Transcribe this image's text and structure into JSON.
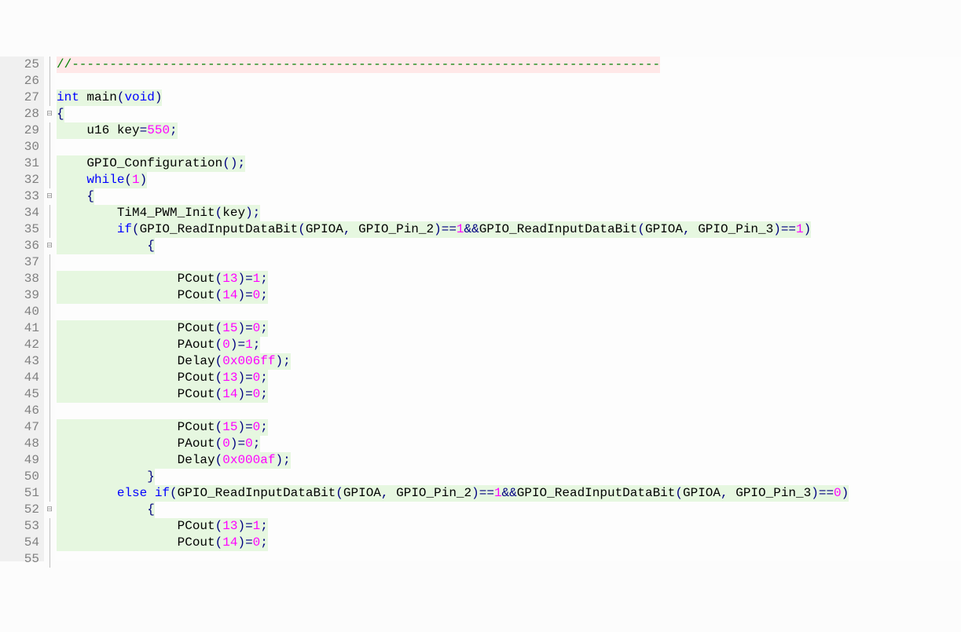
{
  "lines": [
    {
      "num": "25",
      "fold": "line",
      "tokens": [
        {
          "cls": "comment hl",
          "t": "//------------------------------------------------------------------------------"
        }
      ]
    },
    {
      "num": "26",
      "fold": "line",
      "tokens": []
    },
    {
      "num": "27",
      "fold": "line",
      "tokens": [
        {
          "cls": "type",
          "t": "int"
        },
        {
          "cls": "plain",
          "t": " main"
        },
        {
          "cls": "punc",
          "t": "("
        },
        {
          "cls": "type",
          "t": "void"
        },
        {
          "cls": "punc",
          "t": ")"
        }
      ]
    },
    {
      "num": "28",
      "fold": "open",
      "tokens": [
        {
          "cls": "punc",
          "t": "{"
        }
      ]
    },
    {
      "num": "29",
      "fold": "line",
      "tokens": [
        {
          "cls": "plain",
          "t": "    u16 key"
        },
        {
          "cls": "operator",
          "t": "="
        },
        {
          "cls": "number",
          "t": "550"
        },
        {
          "cls": "punc",
          "t": ";"
        }
      ]
    },
    {
      "num": "30",
      "fold": "line",
      "tokens": []
    },
    {
      "num": "31",
      "fold": "line",
      "tokens": [
        {
          "cls": "plain",
          "t": "    GPIO_Configuration"
        },
        {
          "cls": "punc",
          "t": "();"
        }
      ]
    },
    {
      "num": "32",
      "fold": "line",
      "tokens": [
        {
          "cls": "plain",
          "t": "    "
        },
        {
          "cls": "keyword",
          "t": "while"
        },
        {
          "cls": "punc",
          "t": "("
        },
        {
          "cls": "number",
          "t": "1"
        },
        {
          "cls": "punc",
          "t": ")"
        }
      ]
    },
    {
      "num": "33",
      "fold": "open",
      "tokens": [
        {
          "cls": "punc",
          "t": "    {"
        }
      ]
    },
    {
      "num": "34",
      "fold": "line",
      "tokens": [
        {
          "cls": "plain",
          "t": "        TiM4_PWM_Init"
        },
        {
          "cls": "punc",
          "t": "("
        },
        {
          "cls": "plain",
          "t": "key"
        },
        {
          "cls": "punc",
          "t": ");"
        }
      ]
    },
    {
      "num": "35",
      "fold": "line",
      "tokens": [
        {
          "cls": "plain",
          "t": "        "
        },
        {
          "cls": "keyword",
          "t": "if"
        },
        {
          "cls": "punc",
          "t": "("
        },
        {
          "cls": "plain",
          "t": "GPIO_ReadInputDataBit"
        },
        {
          "cls": "punc",
          "t": "("
        },
        {
          "cls": "plain",
          "t": "GPIOA"
        },
        {
          "cls": "punc",
          "t": ", "
        },
        {
          "cls": "plain",
          "t": "GPIO_Pin_2"
        },
        {
          "cls": "punc",
          "t": ")"
        },
        {
          "cls": "operator",
          "t": "=="
        },
        {
          "cls": "number",
          "t": "1"
        },
        {
          "cls": "operator",
          "t": "&&"
        },
        {
          "cls": "plain",
          "t": "GPIO_ReadInputDataBit"
        },
        {
          "cls": "punc",
          "t": "("
        },
        {
          "cls": "plain",
          "t": "GPIOA"
        },
        {
          "cls": "punc",
          "t": ", "
        },
        {
          "cls": "plain",
          "t": "GPIO_Pin_3"
        },
        {
          "cls": "punc",
          "t": ")"
        },
        {
          "cls": "operator",
          "t": "=="
        },
        {
          "cls": "number",
          "t": "1"
        },
        {
          "cls": "punc",
          "t": ")"
        }
      ]
    },
    {
      "num": "36",
      "fold": "open",
      "tokens": [
        {
          "cls": "punc",
          "t": "            {"
        }
      ]
    },
    {
      "num": "37",
      "fold": "line",
      "tokens": []
    },
    {
      "num": "38",
      "fold": "line",
      "tokens": [
        {
          "cls": "plain",
          "t": "                PCout"
        },
        {
          "cls": "punc",
          "t": "("
        },
        {
          "cls": "number",
          "t": "13"
        },
        {
          "cls": "punc",
          "t": ")"
        },
        {
          "cls": "operator",
          "t": "="
        },
        {
          "cls": "number",
          "t": "1"
        },
        {
          "cls": "punc",
          "t": ";"
        }
      ]
    },
    {
      "num": "39",
      "fold": "line",
      "tokens": [
        {
          "cls": "plain",
          "t": "                PCout"
        },
        {
          "cls": "punc",
          "t": "("
        },
        {
          "cls": "number",
          "t": "14"
        },
        {
          "cls": "punc",
          "t": ")"
        },
        {
          "cls": "operator",
          "t": "="
        },
        {
          "cls": "number",
          "t": "0"
        },
        {
          "cls": "punc",
          "t": ";"
        }
      ]
    },
    {
      "num": "40",
      "fold": "line",
      "tokens": []
    },
    {
      "num": "41",
      "fold": "line",
      "tokens": [
        {
          "cls": "plain",
          "t": "                PCout"
        },
        {
          "cls": "punc",
          "t": "("
        },
        {
          "cls": "number",
          "t": "15"
        },
        {
          "cls": "punc",
          "t": ")"
        },
        {
          "cls": "operator",
          "t": "="
        },
        {
          "cls": "number",
          "t": "0"
        },
        {
          "cls": "punc",
          "t": ";"
        }
      ]
    },
    {
      "num": "42",
      "fold": "line",
      "tokens": [
        {
          "cls": "plain",
          "t": "                PAout"
        },
        {
          "cls": "punc",
          "t": "("
        },
        {
          "cls": "number",
          "t": "0"
        },
        {
          "cls": "punc",
          "t": ")"
        },
        {
          "cls": "operator",
          "t": "="
        },
        {
          "cls": "number",
          "t": "1"
        },
        {
          "cls": "punc",
          "t": ";"
        }
      ]
    },
    {
      "num": "43",
      "fold": "line",
      "tokens": [
        {
          "cls": "plain",
          "t": "                Delay"
        },
        {
          "cls": "punc",
          "t": "("
        },
        {
          "cls": "hex",
          "t": "0x006ff"
        },
        {
          "cls": "punc",
          "t": ");"
        }
      ]
    },
    {
      "num": "44",
      "fold": "line",
      "tokens": [
        {
          "cls": "plain",
          "t": "                PCout"
        },
        {
          "cls": "punc",
          "t": "("
        },
        {
          "cls": "number",
          "t": "13"
        },
        {
          "cls": "punc",
          "t": ")"
        },
        {
          "cls": "operator",
          "t": "="
        },
        {
          "cls": "number",
          "t": "0"
        },
        {
          "cls": "punc",
          "t": ";"
        }
      ]
    },
    {
      "num": "45",
      "fold": "line",
      "tokens": [
        {
          "cls": "plain",
          "t": "                PCout"
        },
        {
          "cls": "punc",
          "t": "("
        },
        {
          "cls": "number",
          "t": "14"
        },
        {
          "cls": "punc",
          "t": ")"
        },
        {
          "cls": "operator",
          "t": "="
        },
        {
          "cls": "number",
          "t": "0"
        },
        {
          "cls": "punc",
          "t": ";"
        }
      ]
    },
    {
      "num": "46",
      "fold": "line",
      "tokens": []
    },
    {
      "num": "47",
      "fold": "line",
      "tokens": [
        {
          "cls": "plain",
          "t": "                PCout"
        },
        {
          "cls": "punc",
          "t": "("
        },
        {
          "cls": "number",
          "t": "15"
        },
        {
          "cls": "punc",
          "t": ")"
        },
        {
          "cls": "operator",
          "t": "="
        },
        {
          "cls": "number",
          "t": "0"
        },
        {
          "cls": "punc",
          "t": ";"
        }
      ]
    },
    {
      "num": "48",
      "fold": "line",
      "tokens": [
        {
          "cls": "plain",
          "t": "                PAout"
        },
        {
          "cls": "punc",
          "t": "("
        },
        {
          "cls": "number",
          "t": "0"
        },
        {
          "cls": "punc",
          "t": ")"
        },
        {
          "cls": "operator",
          "t": "="
        },
        {
          "cls": "number",
          "t": "0"
        },
        {
          "cls": "punc",
          "t": ";"
        }
      ]
    },
    {
      "num": "49",
      "fold": "line",
      "tokens": [
        {
          "cls": "plain",
          "t": "                Delay"
        },
        {
          "cls": "punc",
          "t": "("
        },
        {
          "cls": "hex",
          "t": "0x000af"
        },
        {
          "cls": "punc",
          "t": ");"
        }
      ]
    },
    {
      "num": "50",
      "fold": "line",
      "tokens": [
        {
          "cls": "punc",
          "t": "            }"
        }
      ]
    },
    {
      "num": "51",
      "fold": "line",
      "tokens": [
        {
          "cls": "plain",
          "t": "        "
        },
        {
          "cls": "keyword",
          "t": "else"
        },
        {
          "cls": "plain",
          "t": " "
        },
        {
          "cls": "keyword",
          "t": "if"
        },
        {
          "cls": "punc",
          "t": "("
        },
        {
          "cls": "plain",
          "t": "GPIO_ReadInputDataBit"
        },
        {
          "cls": "punc",
          "t": "("
        },
        {
          "cls": "plain",
          "t": "GPIOA"
        },
        {
          "cls": "punc",
          "t": ", "
        },
        {
          "cls": "plain",
          "t": "GPIO_Pin_2"
        },
        {
          "cls": "punc",
          "t": ")"
        },
        {
          "cls": "operator",
          "t": "=="
        },
        {
          "cls": "number",
          "t": "1"
        },
        {
          "cls": "operator",
          "t": "&&"
        },
        {
          "cls": "plain",
          "t": "GPIO_ReadInputDataBit"
        },
        {
          "cls": "punc",
          "t": "("
        },
        {
          "cls": "plain",
          "t": "GPIOA"
        },
        {
          "cls": "punc",
          "t": ", "
        },
        {
          "cls": "plain",
          "t": "GPIO_Pin_3"
        },
        {
          "cls": "punc",
          "t": ")"
        },
        {
          "cls": "operator",
          "t": "=="
        },
        {
          "cls": "number",
          "t": "0"
        },
        {
          "cls": "punc",
          "t": ")"
        }
      ]
    },
    {
      "num": "52",
      "fold": "open",
      "tokens": [
        {
          "cls": "punc",
          "t": "            {"
        }
      ]
    },
    {
      "num": "53",
      "fold": "line",
      "tokens": [
        {
          "cls": "plain",
          "t": "                PCout"
        },
        {
          "cls": "punc",
          "t": "("
        },
        {
          "cls": "number",
          "t": "13"
        },
        {
          "cls": "punc",
          "t": ")"
        },
        {
          "cls": "operator",
          "t": "="
        },
        {
          "cls": "number",
          "t": "1"
        },
        {
          "cls": "punc",
          "t": ";"
        }
      ]
    },
    {
      "num": "54",
      "fold": "line",
      "tokens": [
        {
          "cls": "plain",
          "t": "                PCout"
        },
        {
          "cls": "punc",
          "t": "("
        },
        {
          "cls": "number",
          "t": "14"
        },
        {
          "cls": "punc",
          "t": ")"
        },
        {
          "cls": "operator",
          "t": "="
        },
        {
          "cls": "number",
          "t": "0"
        },
        {
          "cls": "punc",
          "t": ";"
        }
      ]
    },
    {
      "num": "55",
      "fold": "line",
      "tokens": []
    }
  ],
  "highlight_bg": "#e6f7e0",
  "fold_icons": {
    "open": "⊟",
    "closed": "⊞"
  }
}
